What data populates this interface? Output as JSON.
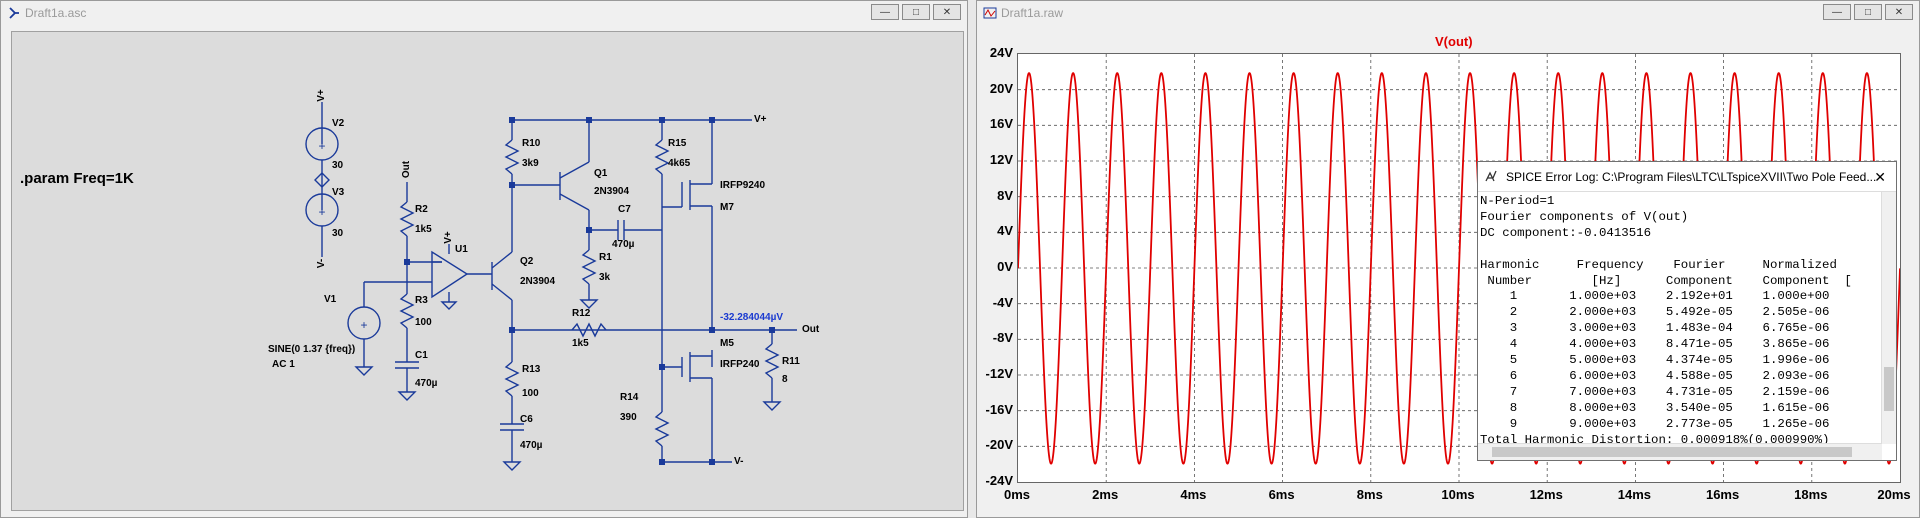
{
  "schematic_window": {
    "title": "Draft1a.asc",
    "param_directive": ".param Freq=1K",
    "labels": {
      "v2": "V2",
      "v2_val": "30",
      "v3": "V3",
      "v3_val": "30",
      "vplus_top": "V+",
      "vminus_left": "V-",
      "out_top": "Out",
      "r2": "R2",
      "r2_val": "1k5",
      "u1": "U1",
      "u1_plus": "V+",
      "v1": "V1",
      "v1_sine": "SINE(0 1.37 {freq})",
      "v1_ac": "AC 1",
      "r3": "R3",
      "r3_val": "100",
      "c1": "C1",
      "c1_val": "470µ",
      "r10": "R10",
      "r10_val": "3k9",
      "q1": "Q1",
      "q1_val": "2N3904",
      "r15": "R15",
      "r15_val": "4k65",
      "m7_part": "IRFP9240",
      "m7": "M7",
      "c7": "C7",
      "c7_val": "470µ",
      "r1": "R1",
      "r1_val": "3k",
      "q2": "Q2",
      "q2_val": "2N3904",
      "r12": "R12",
      "r12_val": "1k5",
      "r13": "R13",
      "r13_val": "100",
      "c6": "C6",
      "c6_val": "470µ",
      "vplus_right": "V+",
      "vminus_right": "V-",
      "out_right": "Out",
      "node_voltage": "-32.284044µV",
      "r11": "R11",
      "r11_val": "8",
      "m5": "M5",
      "m5_part": "IRFP240",
      "r14": "R14",
      "r14_val": "390"
    }
  },
  "waveform_window": {
    "title": "Draft1a.raw",
    "trace_name": "V(out)",
    "trace_color": "#e00000"
  },
  "chart_data": {
    "type": "line",
    "title": "V(out)",
    "x_ticks": [
      "0ms",
      "2ms",
      "4ms",
      "6ms",
      "8ms",
      "10ms",
      "12ms",
      "14ms",
      "16ms",
      "18ms",
      "20ms"
    ],
    "y_ticks": [
      "24V",
      "20V",
      "16V",
      "12V",
      "8V",
      "4V",
      "0V",
      "-4V",
      "-8V",
      "-12V",
      "-16V",
      "-20V",
      "-24V"
    ],
    "xlim": [
      0,
      20
    ],
    "ylim": [
      -24,
      24
    ],
    "grid": true,
    "series": [
      {
        "name": "V(out)",
        "function": "sine",
        "amplitude_v": 21.9,
        "frequency_khz": 1,
        "offset_v": -0.04,
        "x_unit": "ms"
      }
    ]
  },
  "error_log": {
    "title": "SPICE Error Log: C:\\Program Files\\LTC\\LTspiceXVII\\Two Pole Feed...",
    "lines": [
      "N-Period=1",
      "Fourier components of V(out)",
      "DC component:-0.0413516",
      "",
      "Harmonic     Frequency    Fourier     Normalized",
      " Number        [Hz]      Component    Component  [",
      "    1       1.000e+03    2.192e+01    1.000e+00",
      "    2       2.000e+03    5.492e-05    2.505e-06",
      "    3       3.000e+03    1.483e-04    6.765e-06",
      "    4       4.000e+03    8.471e-05    3.865e-06",
      "    5       5.000e+03    4.374e-05    1.996e-06",
      "    6       6.000e+03    4.588e-05    2.093e-06",
      "    7       7.000e+03    4.731e-05    2.159e-06",
      "    8       8.000e+03    3.540e-05    1.615e-06",
      "    9       9.000e+03    2.773e-05    1.265e-06",
      "Total Harmonic Distortion: 0.000918%(0.000990%)"
    ]
  },
  "window_buttons": {
    "minimize": "—",
    "maximize": "□",
    "close": "✕"
  }
}
